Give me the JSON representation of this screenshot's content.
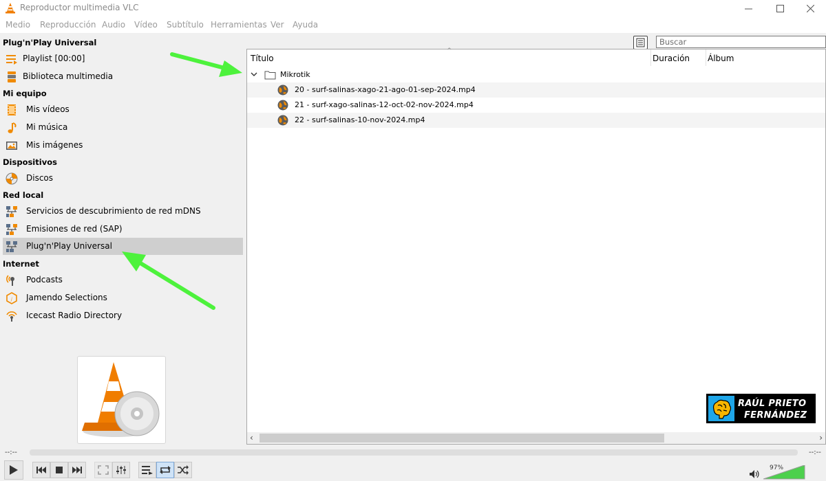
{
  "window": {
    "title": "Reproductor multimedia VLC",
    "icon": "vlc-cone-icon",
    "controls": [
      "minimize-icon",
      "maximize-icon",
      "close-icon"
    ]
  },
  "menu": [
    "Medio",
    "Reproducción",
    "Audio",
    "Vídeo",
    "Subtítulo",
    "Herramientas",
    "Ver",
    "Ayuda"
  ],
  "sidebar": {
    "current_title": "Plug'n'Play Universal",
    "top_items": [
      {
        "label": "Playlist [00:00]",
        "icon": "playlist-icon"
      },
      {
        "label": "Biblioteca multimedia",
        "icon": "media-library-icon"
      }
    ],
    "sections": [
      {
        "title": "Mi equipo",
        "items": [
          {
            "label": "Mis vídeos",
            "icon": "film-icon"
          },
          {
            "label": "Mi música",
            "icon": "music-note-icon"
          },
          {
            "label": "Mis imágenes",
            "icon": "image-icon"
          }
        ]
      },
      {
        "title": "Dispositivos",
        "items": [
          {
            "label": "Discos",
            "icon": "disc-icon"
          }
        ]
      },
      {
        "title": "Red local",
        "items": [
          {
            "label": "Servicios de descubrimiento de red mDNS",
            "icon": "network-icon"
          },
          {
            "label": "Emisiones de red (SAP)",
            "icon": "network-icon"
          },
          {
            "label": "Plug'n'Play Universal",
            "icon": "network-icon",
            "selected": true
          }
        ]
      },
      {
        "title": "Internet",
        "items": [
          {
            "label": "Podcasts",
            "icon": "podcast-icon"
          },
          {
            "label": "Jamendo Selections",
            "icon": "jamendo-icon"
          },
          {
            "label": "Icecast Radio Directory",
            "icon": "radio-icon"
          }
        ]
      }
    ]
  },
  "search": {
    "placeholder": "Buscar"
  },
  "list": {
    "columns": [
      "Título",
      "Duración",
      "Álbum"
    ],
    "folder": "Mikrotik",
    "files": [
      "20 - surf-salinas-xago-21-ago-01-sep-2024.mp4",
      "21 - surf-xago-salinas-12-oct-02-nov-2024.mp4",
      "22 - surf-salinas-10-nov-2024.mp4"
    ]
  },
  "watermark": {
    "line1": "RAÚL PRIETO",
    "line2": "FERNÁNDEZ"
  },
  "player": {
    "elapsed": "--:--",
    "remaining": "--:--",
    "progress": 0,
    "volume_label": "97%",
    "volume": 0.97
  },
  "colors": {
    "annotation_arrow": "#4df23c",
    "vlc_orange": "#f07d00",
    "selected_row": "#cfcfcf"
  }
}
